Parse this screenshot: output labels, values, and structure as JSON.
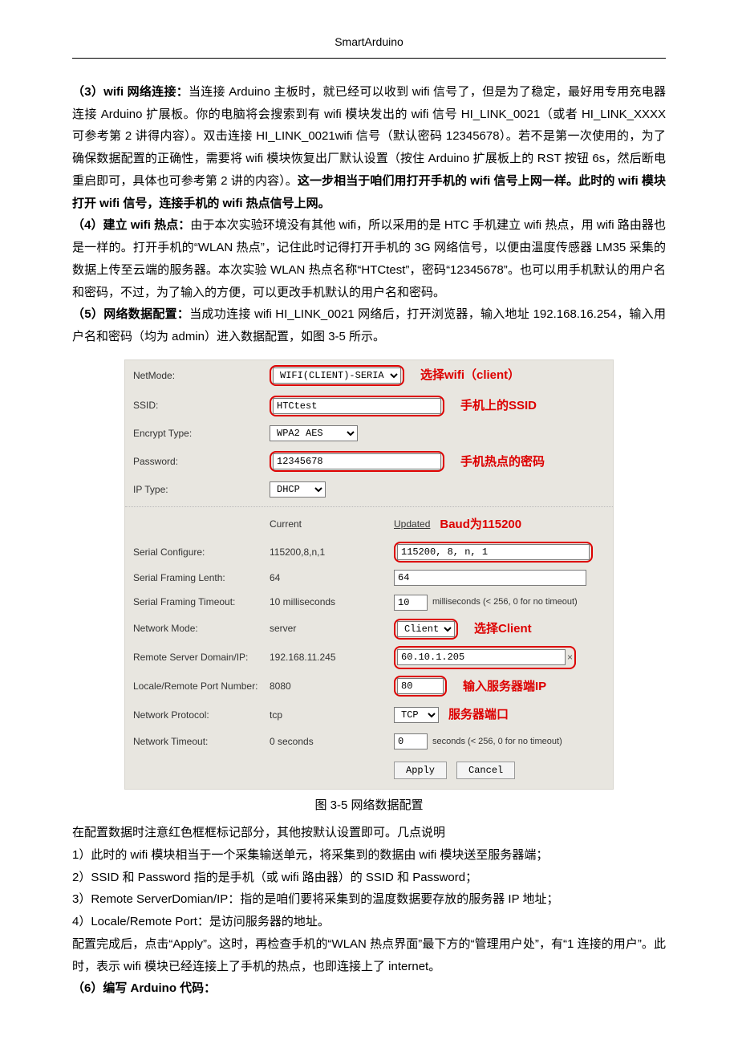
{
  "header": {
    "title": "SmartArduino"
  },
  "body": {
    "p3_label": "（3）wifi 网络连接：",
    "p3": "当连接 Arduino 主板时，就已经可以收到 wifi 信号了，但是为了稳定，最好用专用充电器连接 Arduino 扩展板。你的电脑将会搜索到有 wifi 模块发出的 wifi 信号 HI_LINK_0021（或者 HI_LINK_XXXX 可参考第 2 讲得内容）。双击连接 HI_LINK_0021wifi 信号（默认密码 12345678）。若不是第一次使用的，为了确保数据配置的正确性，需要将 wifi 模块恢复出厂默认设置（按住 Arduino 扩展板上的 RST 按钮 6s，然后断电重启即可，具体也可参考第 2 讲的内容）。",
    "p3_bold_tail": "这一步相当于咱们用打开手机的 wifi 信号上网一样。此时的 wifi 模块打开 wifi 信号，连接手机的 wifi 热点信号上网。",
    "p4_label": "（4）建立 wifi 热点：",
    "p4": "由于本次实验环境没有其他 wifi，所以采用的是 HTC 手机建立 wifi 热点，用 wifi 路由器也是一样的。打开手机的“WLAN 热点”，记住此时记得打开手机的 3G 网络信号，以便由温度传感器 LM35 采集的数据上传至云端的服务器。本次实验 WLAN 热点名称“HTCtest”，密码“12345678”。也可以用手机默认的用户名和密码，不过，为了输入的方便，可以更改手机默认的用户名和密码。",
    "p5_label": "（5）网络数据配置：",
    "p5": "当成功连接 wifi HI_LINK_0021 网络后，打开浏览器，输入地址 192.168.16.254，输入用户名和密码（均为 admin）进入数据配置，如图 3-5 所示。",
    "caption": "图 3-5  网络数据配置",
    "after1": "在配置数据时注意红色框框标记部分，其他按默认设置即可。几点说明",
    "after2": "1）此时的 wifi 模块相当于一个采集输送单元，将采集到的数据由 wifi 模块送至服务器端；",
    "after3": "2）SSID 和 Password 指的是手机（或 wifi 路由器）的 SSID 和 Password；",
    "after4": "3）Remote ServerDomian/IP：指的是咱们要将采集到的温度数据要存放的服务器 IP 地址；",
    "after5": "4）Locale/Remote Port：是访问服务器的地址。",
    "after6": "配置完成后，点击“Apply”。这时，再检查手机的“WLAN 热点界面”最下方的“管理用户处”，有“1 连接的用户”。此时，表示 wifi 模块已经连接上了手机的热点，也即连接上了 internet。",
    "p6_label": "（6）编写 Arduino  代码："
  },
  "cfg": {
    "labels": {
      "netmode": "NetMode:",
      "ssid": "SSID:",
      "enc": "Encrypt Type:",
      "pwd": "Password:",
      "iptype": "IP Type:",
      "current": "Current",
      "updated": "Updated",
      "serialcfg": "Serial Configure:",
      "framelen": "Serial Framing Lenth:",
      "frametimeout": "Serial Framing Timeout:",
      "netmode2": "Network Mode:",
      "remote": "Remote Server Domain/IP:",
      "port": "Locale/Remote Port Number:",
      "proto": "Network Protocol:",
      "nettimeout": "Network Timeout:"
    },
    "values": {
      "netmode": "WIFI(CLIENT)-SERIAL",
      "ssid": "HTCtest",
      "enc": "WPA2 AES",
      "pwd": "12345678",
      "iptype": "DHCP",
      "serialcfg_cur": "115200,8,n,1",
      "serialcfg_upd": "115200, 8, n, 1",
      "framelen_cur": "64",
      "framelen_upd": "64",
      "frametimeout_cur": "10 milliseconds",
      "frametimeout_upd": "10",
      "frametimeout_hint": "milliseconds (< 256, 0 for no timeout)",
      "netmode2_cur": "server",
      "netmode2_upd": "Client",
      "remote_cur": "192.168.11.245",
      "remote_upd": "60.10.1.205",
      "port_cur": "8080",
      "port_upd": "80",
      "proto_cur": "tcp",
      "proto_upd": "TCP",
      "nettimeout_cur": "0 seconds",
      "nettimeout_upd": "0",
      "nettimeout_hint": "seconds (< 256, 0 for no timeout)"
    },
    "buttons": {
      "apply": "Apply",
      "cancel": "Cancel"
    },
    "ann": {
      "netmode": "选择wifi（client）",
      "ssid": "手机上的SSID",
      "pwd": "手机热点的密码",
      "baud": "Baud为115200",
      "client": "选择Client",
      "ip": "输入服务器端IP",
      "port": "服务器端口"
    }
  }
}
